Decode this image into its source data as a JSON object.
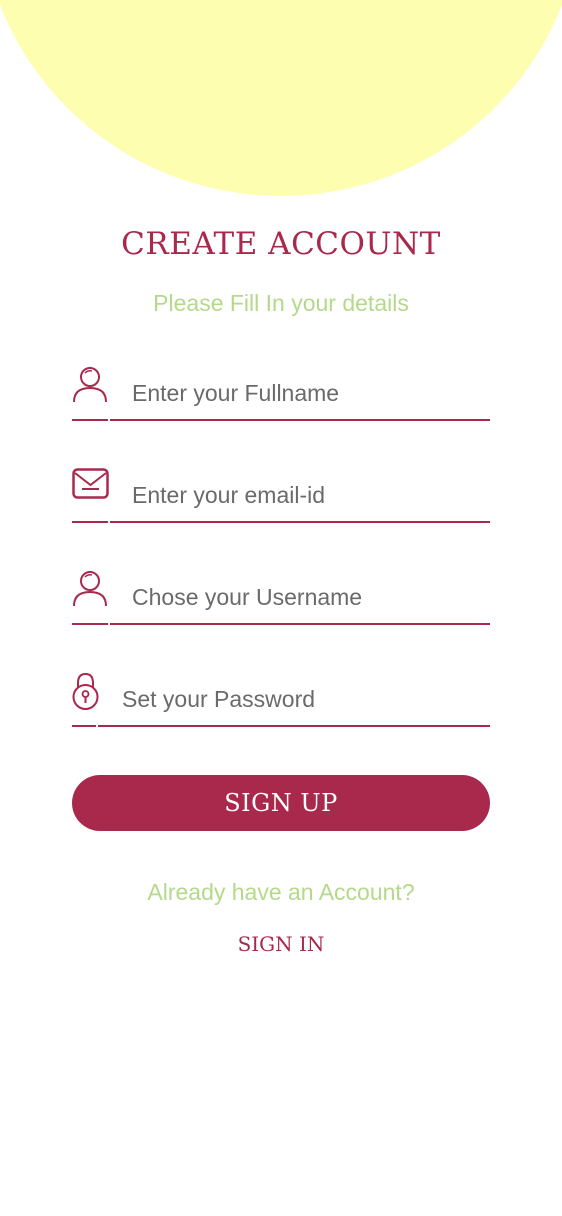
{
  "header": {
    "title": "CREATE ACCOUNT",
    "subtitle": "Please Fill In your details"
  },
  "form": {
    "fields": [
      {
        "icon": "user-icon",
        "placeholder": "Enter your Fullname",
        "value": ""
      },
      {
        "icon": "mail-icon",
        "placeholder": "Enter your email-id",
        "value": ""
      },
      {
        "icon": "user-icon",
        "placeholder": "Chose your Username",
        "value": ""
      },
      {
        "icon": "lock-icon",
        "placeholder": "Set your Password",
        "value": ""
      }
    ],
    "submit_label": "SIGN UP"
  },
  "footer": {
    "prompt": "Already have an Account?",
    "link_label": "SIGN IN"
  },
  "colors": {
    "accent": "#a8294c",
    "subtitle": "#b5d98a",
    "background_blob": "#fefeb1"
  }
}
